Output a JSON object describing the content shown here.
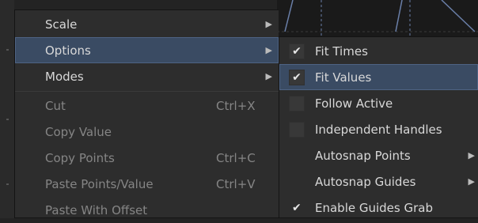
{
  "main_menu": {
    "items": [
      {
        "label": "Scale",
        "shortcut": "",
        "submenu": true,
        "disabled": false,
        "highlight": false
      },
      {
        "label": "Options",
        "shortcut": "",
        "submenu": true,
        "disabled": false,
        "highlight": true
      },
      {
        "label": "Modes",
        "shortcut": "",
        "submenu": true,
        "disabled": false,
        "highlight": false
      },
      {
        "label": "Cut",
        "shortcut": "Ctrl+X",
        "submenu": false,
        "disabled": true,
        "highlight": false
      },
      {
        "label": "Copy Value",
        "shortcut": "",
        "submenu": false,
        "disabled": true,
        "highlight": false
      },
      {
        "label": "Copy Points",
        "shortcut": "Ctrl+C",
        "submenu": false,
        "disabled": true,
        "highlight": false
      },
      {
        "label": "Paste Points/Value",
        "shortcut": "Ctrl+V",
        "submenu": false,
        "disabled": true,
        "highlight": false
      },
      {
        "label": "Paste With Offset",
        "shortcut": "",
        "submenu": false,
        "disabled": true,
        "highlight": false
      }
    ]
  },
  "options_submenu": {
    "items": [
      {
        "label": "Fit Times",
        "checked": true,
        "checkbox_style": "box",
        "submenu": false,
        "highlight": false
      },
      {
        "label": "Fit Values",
        "checked": true,
        "checkbox_style": "box",
        "submenu": false,
        "highlight": true
      },
      {
        "label": "Follow Active",
        "checked": false,
        "checkbox_style": "box",
        "submenu": false,
        "highlight": false
      },
      {
        "label": "Independent Handles",
        "checked": false,
        "checkbox_style": "box",
        "submenu": false,
        "highlight": false
      },
      {
        "label": "Autosnap Points",
        "checked": false,
        "checkbox_style": "none",
        "submenu": true,
        "highlight": false
      },
      {
        "label": "Autosnap Guides",
        "checked": false,
        "checkbox_style": "none",
        "submenu": true,
        "highlight": false
      },
      {
        "label": "Enable Guides Grab",
        "checked": true,
        "checkbox_style": "mark",
        "submenu": false,
        "highlight": false
      }
    ]
  },
  "glyphs": {
    "submenu_arrow": "▶",
    "check": "✔"
  },
  "colors": {
    "menu_bg": "#2d2d2d",
    "highlight": "#3a4b63",
    "text": "#d8d8d8",
    "disabled_text": "#858585"
  }
}
